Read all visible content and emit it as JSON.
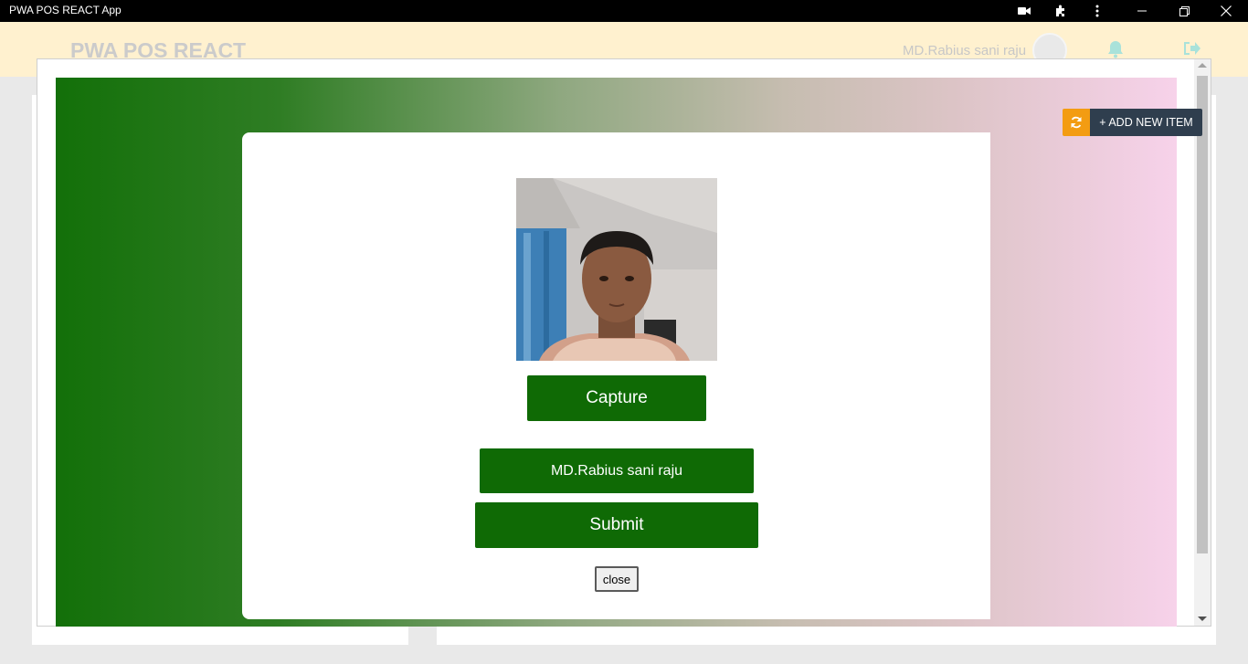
{
  "window": {
    "title": "PWA POS REACT App",
    "icons": [
      "camera-icon",
      "extension-icon",
      "more-vert-icon",
      "minimize-icon",
      "restore-icon",
      "close-icon"
    ]
  },
  "header": {
    "logo": "PWA POS REACT",
    "user_name": "MD.Rabius sani raju",
    "icons": [
      "avatar",
      "bell-icon",
      "logout-icon"
    ]
  },
  "toolbar": {
    "add_item_label": "+ ADD NEW ITEM",
    "refresh_icon": "refresh-icon",
    "refresh_color": "#f39c12",
    "add_color": "#2f3e4e"
  },
  "modal": {
    "capture_label": "Capture",
    "name_value": "MD.Rabius sani raju",
    "submit_label": "Submit",
    "close_label": "close",
    "button_color": "#0f6a05"
  }
}
